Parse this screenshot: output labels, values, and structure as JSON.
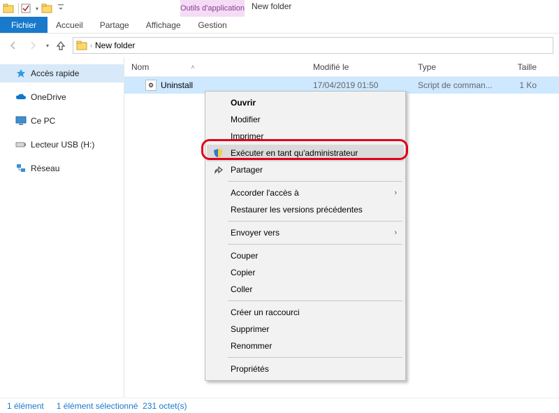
{
  "window": {
    "title": "New folder"
  },
  "context_tab": {
    "header": "Outils d'application",
    "tab": "Gestion"
  },
  "ribbon": {
    "file": "Fichier",
    "tabs": [
      "Accueil",
      "Partage",
      "Affichage"
    ]
  },
  "address": {
    "crumbs": [
      "New folder"
    ]
  },
  "sidebar": {
    "items": [
      {
        "label": "Accès rapide",
        "icon": "star"
      },
      {
        "label": "OneDrive",
        "icon": "cloud"
      },
      {
        "label": "Ce PC",
        "icon": "pc"
      },
      {
        "label": "Lecteur USB (H:)",
        "icon": "usb"
      },
      {
        "label": "Réseau",
        "icon": "network"
      }
    ]
  },
  "columns": {
    "name": "Nom",
    "modified": "Modifié le",
    "type": "Type",
    "size": "Taille"
  },
  "files": [
    {
      "name": "Uninstall",
      "modified": "17/04/2019 01:50",
      "type": "Script de comman...",
      "size": "1 Ko"
    }
  ],
  "status": {
    "count": "1 élément",
    "selection": "1 élément sélectionné",
    "bytes": "231 octet(s)"
  },
  "context_menu": {
    "open": "Ouvrir",
    "edit": "Modifier",
    "print": "Imprimer",
    "run_admin": "Exécuter en tant qu'administrateur",
    "share": "Partager",
    "grant_access": "Accorder l'accès à",
    "restore": "Restaurer les versions précédentes",
    "send_to": "Envoyer vers",
    "cut": "Couper",
    "copy": "Copier",
    "paste": "Coller",
    "shortcut": "Créer un raccourci",
    "delete": "Supprimer",
    "rename": "Renommer",
    "properties": "Propriétés"
  }
}
